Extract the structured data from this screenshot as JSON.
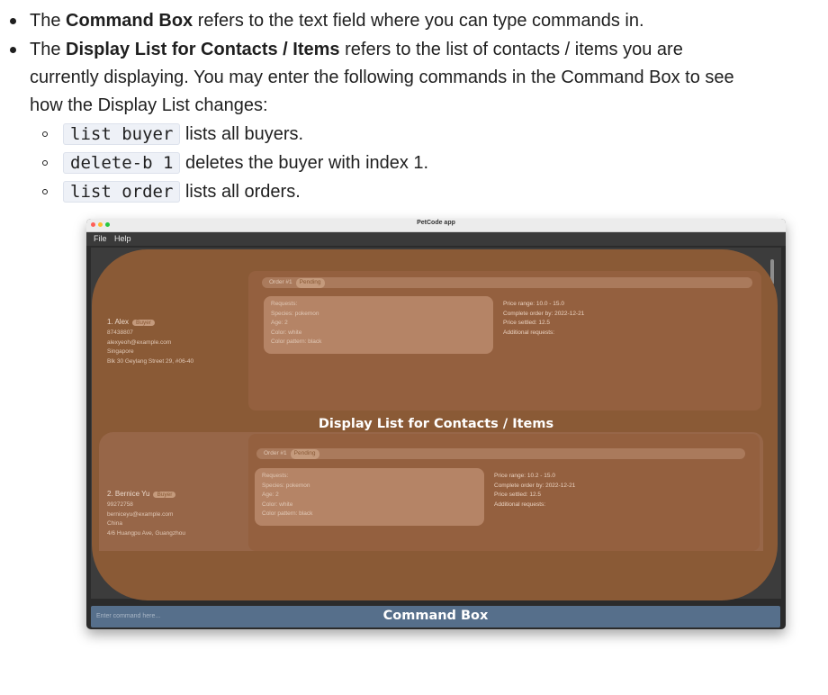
{
  "bullets": {
    "b1_pre": "The ",
    "b1_bold": "Command Box",
    "b1_post": " refers to the text field where you can type commands in.",
    "b2_pre": "The ",
    "b2_bold": "Display List for Contacts / Items",
    "b2_post": " refers to the list of contacts / items you are",
    "b2_line2": "currently displaying. You may enter the following commands in the Command Box to see",
    "b2_line3": "how the Display List changes:"
  },
  "commands": [
    {
      "code": "list buyer",
      "desc": " lists all buyers."
    },
    {
      "code": "delete-b 1",
      "desc": " deletes the buyer with index 1."
    },
    {
      "code": "list order",
      "desc": " lists all orders."
    }
  ],
  "app": {
    "title": "PetCode app",
    "menu": {
      "file": "File",
      "help": "Help"
    },
    "display_label": "Display List for Contacts / Items",
    "command_label": "Command Box",
    "command_placeholder": "Enter command here...",
    "buyers": [
      {
        "name": "1. Alex",
        "tag": "Buyer",
        "phone": "87438807",
        "email": "alexyeoh@example.com",
        "country": "Singapore",
        "address": "Blk 30 Geylang Street 29, #06-40",
        "order_title": "Order #1",
        "order_status": "Pending",
        "req_header": "Requests:",
        "species": "Species: pokemon",
        "age": "Age: 2",
        "color": "Color: white",
        "pattern": "Color pattern: black",
        "price_range": "Price range: 10.0 - 15.0",
        "complete_by": "Complete order by: 2022-12-21",
        "price_settled": "Price settled: 12.5",
        "additional": "Additional requests:"
      },
      {
        "name": "2. Bernice Yu",
        "tag": "Buyer",
        "phone": "99272758",
        "email": "berniceyu@example.com",
        "country": "China",
        "address": "4/6 Huangpu Ave, Guangzhou",
        "order_title": "Order #1",
        "order_status": "Pending",
        "req_header": "Requests:",
        "species": "Species: pokemon",
        "age": "Age: 2",
        "color": "Color: white",
        "pattern": "Color pattern: black",
        "price_range": "Price range: 10.2 - 15.0",
        "complete_by": "Complete order by: 2022-12-21",
        "price_settled": "Price settled: 12.5",
        "additional": "Additional requests:"
      }
    ]
  },
  "colors": {
    "overlay": "#8a5a36",
    "command_box": "#566f8b",
    "window_bg": "#2b2b2b"
  }
}
